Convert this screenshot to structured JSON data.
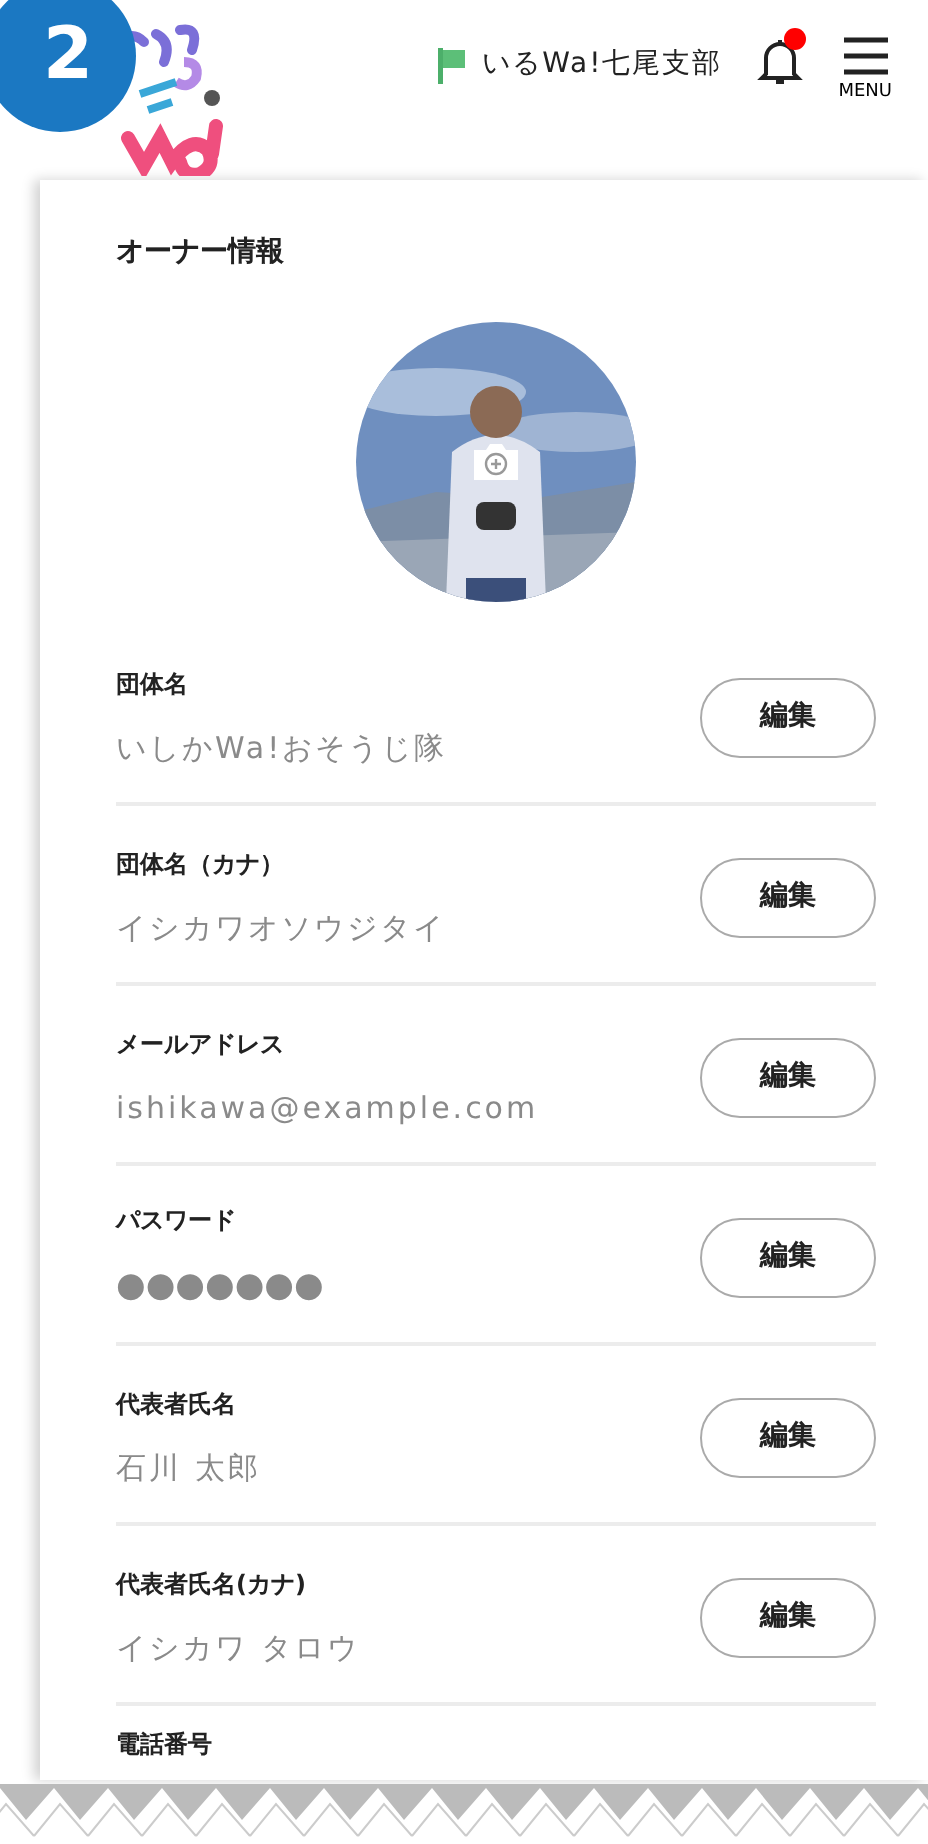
{
  "step_badge": "2",
  "header": {
    "branch": "いるWa!七尾支部",
    "unread": true,
    "menu_label": "MENU"
  },
  "section_title": "オーナー情報",
  "fields": [
    {
      "kind": "text",
      "label": "団体名",
      "value": "いしかWa!おそうじ隊",
      "button": "編集"
    },
    {
      "kind": "text",
      "label": "団体名（カナ）",
      "value": "イシカワオソウジタイ",
      "button": "編集"
    },
    {
      "kind": "text",
      "label": "メールアドレス",
      "value": "ishikawa@example.com",
      "button": "編集"
    },
    {
      "kind": "masked",
      "label": "パスワード",
      "value": "●●●●●●●",
      "button": "編集"
    },
    {
      "kind": "text",
      "label": "代表者氏名",
      "value": "石川 太郎",
      "button": "編集"
    },
    {
      "kind": "text",
      "label": "代表者氏名(カナ)",
      "value": "イシカワ タロウ",
      "button": "編集"
    },
    {
      "kind": "text",
      "label": "電話番号"
    }
  ]
}
